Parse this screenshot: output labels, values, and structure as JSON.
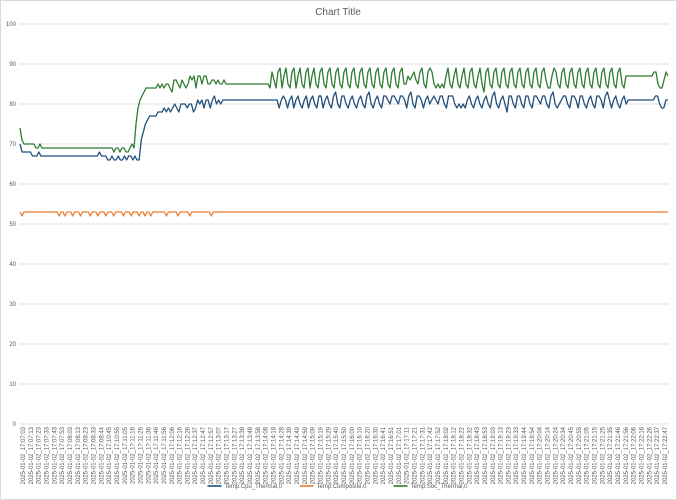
{
  "chart_data": {
    "type": "line",
    "title": "Chart Title",
    "xlabel": "",
    "ylabel": "",
    "ylim": [
      0,
      100
    ],
    "yticks": [
      0,
      10,
      20,
      30,
      40,
      50,
      60,
      70,
      80,
      90,
      100
    ],
    "grid": true,
    "legend_position": "bottom",
    "x_tick_labels": [
      "2025-01-02_17:07:03",
      "2025-01-02_17:07:13",
      "2025-01-02_17:07:23",
      "2025-01-02_17:07:33",
      "2025-01-02_17:07:43",
      "2025-01-02_17:07:53",
      "2025-01-02_17:08:03",
      "2025-01-02_17:08:13",
      "2025-01-02_17:08:23",
      "2025-01-02_17:08:33",
      "2025-01-02_17:08:44",
      "2025-01-02_17:10:45",
      "2025-01-02_17:10:55",
      "2025-01-02_17:11:05",
      "2025-01-02_17:11:16",
      "2025-01-02_17:11:26",
      "2025-01-02_17:11:36",
      "2025-01-02_17:11:46",
      "2025-01-02_17:11:56",
      "2025-01-02_17:12:06",
      "2025-01-02_17:12:16",
      "2025-01-02_17:12:26",
      "2025-01-02_17:12:37",
      "2025-01-02_17:12:47",
      "2025-01-02_17:12:57",
      "2025-01-02_17:13:07",
      "2025-01-02_17:13:17",
      "2025-01-02_17:13:27",
      "2025-01-02_17:13:38",
      "2025-01-02_17:13:48",
      "2025-01-02_17:13:58",
      "2025-01-02_17:14:08",
      "2025-01-02_17:14:18",
      "2025-01-02_17:14:28",
      "2025-01-02_17:14:39",
      "2025-01-02_17:14:49",
      "2025-01-02_17:14:59",
      "2025-01-02_17:15:09",
      "2025-01-02_17:15:19",
      "2025-01-02_17:15:29",
      "2025-01-02_17:15:40",
      "2025-01-02_17:15:50",
      "2025-01-02_17:16:00",
      "2025-01-02_17:16:10",
      "2025-01-02_17:16:20",
      "2025-01-02_17:16:30",
      "2025-01-02_17:16:41",
      "2025-01-02_17:16:51",
      "2025-01-02_17:17:01",
      "2025-01-02_17:17:11",
      "2025-01-02_17:17:21",
      "2025-01-02_17:17:31",
      "2025-01-02_17:17:42",
      "2025-01-02_17:17:52",
      "2025-01-02_17:18:02",
      "2025-01-02_17:18:12",
      "2025-01-02_17:18:22",
      "2025-01-02_17:18:32",
      "2025-01-02_17:18:43",
      "2025-01-02_17:18:53",
      "2025-01-02_17:19:03",
      "2025-01-02_17:19:13",
      "2025-01-02_17:19:23",
      "2025-01-02_17:19:33",
      "2025-01-02_17:19:44",
      "2025-01-02_17:19:54",
      "2025-01-02_17:20:04",
      "2025-01-02_17:20:14",
      "2025-01-02_17:20:24",
      "2025-01-02_17:20:34",
      "2025-01-02_17:20:45",
      "2025-01-02_17:20:55",
      "2025-01-02_17:21:05",
      "2025-01-02_17:21:15",
      "2025-01-02_17:21:25",
      "2025-01-02_17:21:35",
      "2025-01-02_17:21:46",
      "2025-01-02_17:21:56",
      "2025-01-02_17:22:06",
      "2025-01-02_17:22:16",
      "2025-01-02_17:22:26",
      "2025-01-02_17:22:37",
      "2025-01-02_17:22:47"
    ],
    "series": [
      {
        "name": "Temp:Cpu_Thermal,0",
        "color": "#1f4e79",
        "values": [
          70,
          68,
          68,
          68,
          68,
          68,
          67,
          67,
          67,
          68,
          67,
          67,
          67,
          67,
          67,
          67,
          67,
          67,
          67,
          67,
          67,
          67,
          67,
          67,
          67,
          67,
          67,
          67,
          67,
          67,
          67,
          67,
          67,
          67,
          67,
          67,
          67,
          67,
          68,
          67,
          67,
          67,
          66,
          66,
          67,
          66,
          66,
          67,
          66,
          66,
          67,
          66,
          67,
          67,
          66,
          67,
          66,
          66,
          71,
          73,
          75,
          76,
          77,
          77,
          77,
          77,
          78,
          78,
          78,
          79,
          78,
          79,
          78,
          79,
          80,
          79,
          78,
          80,
          80,
          80,
          79,
          80,
          80,
          78,
          79,
          81,
          80,
          81,
          79,
          81,
          81,
          79,
          81,
          82,
          80,
          81,
          80,
          81,
          81,
          81,
          81,
          81,
          81,
          81,
          81,
          81,
          81,
          81,
          81,
          81,
          81,
          81,
          81,
          81,
          81,
          81,
          81,
          81,
          81,
          81,
          81,
          81,
          81,
          81,
          79,
          81,
          82,
          81,
          79,
          81,
          82,
          79,
          81,
          82,
          80,
          79,
          81,
          82,
          79,
          81,
          82,
          80,
          79,
          82,
          82,
          79,
          81,
          82,
          80,
          79,
          82,
          83,
          80,
          79,
          82,
          82,
          80,
          79,
          81,
          82,
          80,
          79,
          81,
          82,
          80,
          79,
          82,
          83,
          80,
          79,
          81,
          82,
          80,
          79,
          82,
          82,
          81,
          80,
          82,
          82,
          81,
          80,
          82,
          82,
          81,
          79,
          82,
          83,
          80,
          79,
          82,
          82,
          81,
          79,
          81,
          82,
          80,
          81,
          82,
          81,
          80,
          82,
          82,
          80,
          79,
          82,
          82,
          82,
          80,
          79,
          80,
          79,
          80,
          79,
          81,
          82,
          80,
          79,
          81,
          82,
          80,
          79,
          81,
          82,
          80,
          79,
          82,
          83,
          80,
          79,
          81,
          82,
          80,
          78,
          82,
          82,
          80,
          79,
          82,
          82,
          80,
          79,
          82,
          82,
          80,
          79,
          82,
          82,
          81,
          80,
          82,
          82,
          80,
          79,
          82,
          83,
          80,
          79,
          80,
          81,
          82,
          82,
          80,
          79,
          82,
          82,
          81,
          79,
          82,
          82,
          80,
          79,
          81,
          82,
          80,
          79,
          82,
          82,
          81,
          79,
          82,
          83,
          81,
          79,
          81,
          82,
          80,
          79,
          81,
          82,
          80,
          81,
          81,
          81,
          81,
          81,
          81,
          81,
          81,
          81,
          81,
          81,
          81,
          81,
          82,
          82,
          80,
          79,
          79,
          81,
          81
        ]
      },
      {
        "name": "Temp:Composite,0",
        "color": "#ed7d31",
        "values": [
          53,
          52,
          53,
          53,
          53,
          53,
          53,
          53,
          53,
          53,
          53,
          53,
          53,
          53,
          53,
          53,
          53,
          53,
          53,
          53,
          52,
          53,
          53,
          52,
          53,
          53,
          53,
          52,
          53,
          53,
          53,
          52,
          53,
          53,
          53,
          53,
          52,
          53,
          53,
          53,
          52,
          53,
          53,
          53,
          52,
          53,
          53,
          53,
          52,
          53,
          53,
          53,
          53,
          52,
          53,
          53,
          53,
          52,
          53,
          53,
          53,
          52,
          53,
          53,
          52,
          53,
          53,
          52,
          53,
          53,
          53,
          53,
          53,
          53,
          53,
          52,
          53,
          53,
          53,
          53,
          53,
          52,
          53,
          53,
          53,
          53,
          53,
          52,
          53,
          53,
          53,
          53,
          53,
          53,
          53,
          53,
          53,
          53,
          52,
          53,
          53,
          53,
          53,
          53,
          53,
          53,
          53,
          53,
          53,
          53,
          53,
          53,
          53,
          53,
          53,
          53,
          53,
          53,
          53,
          53,
          53,
          53,
          53,
          53,
          53,
          53,
          53,
          53,
          53,
          53,
          53,
          53,
          53,
          53,
          53,
          53,
          53,
          53,
          53,
          53,
          53,
          53,
          53,
          53,
          53,
          53,
          53,
          53,
          53,
          53,
          53,
          53,
          53,
          53,
          53,
          53,
          53,
          53,
          53,
          53,
          53,
          53,
          53,
          53,
          53,
          53,
          53,
          53,
          53,
          53,
          53,
          53,
          53,
          53,
          53,
          53,
          53,
          53,
          53,
          53,
          53,
          53,
          53,
          53,
          53,
          53,
          53,
          53,
          53,
          53,
          53,
          53,
          53,
          53,
          53,
          53,
          53,
          53,
          53,
          53,
          53,
          53,
          53,
          53,
          53,
          53,
          53,
          53,
          53,
          53,
          53,
          53,
          53,
          53,
          53,
          53,
          53,
          53,
          53,
          53,
          53,
          53,
          53,
          53,
          53,
          53,
          53,
          53,
          53,
          53,
          53,
          53,
          53,
          53,
          53,
          53,
          53,
          53,
          53,
          53,
          53,
          53,
          53,
          53,
          53,
          53,
          53,
          53,
          53,
          53,
          53,
          53,
          53,
          53,
          53,
          53,
          53,
          53,
          53,
          53,
          53,
          53,
          53,
          53,
          53,
          53,
          53,
          53,
          53,
          53,
          53,
          53,
          53,
          53,
          53,
          53,
          53,
          53,
          53,
          53,
          53,
          53,
          53,
          53,
          53,
          53,
          53,
          53,
          53,
          53,
          53,
          53,
          53,
          53,
          53,
          53,
          53,
          53,
          53,
          53,
          53,
          53,
          53,
          53,
          53,
          53,
          53,
          53,
          53,
          53,
          53,
          53,
          53,
          53,
          53,
          53,
          53,
          53,
          53,
          53,
          53,
          53,
          53,
          53,
          53,
          53,
          53,
          53,
          53,
          53,
          53,
          53,
          53
        ]
      },
      {
        "name": "Temp:Soc_Thermal,0",
        "color": "#2e7d32",
        "values": [
          74,
          71,
          70,
          70,
          70,
          70,
          70,
          70,
          69,
          69,
          70,
          69,
          69,
          69,
          69,
          69,
          69,
          69,
          69,
          69,
          69,
          69,
          69,
          69,
          69,
          69,
          69,
          69,
          69,
          69,
          69,
          69,
          69,
          69,
          69,
          69,
          69,
          69,
          69,
          69,
          69,
          69,
          69,
          69,
          69,
          69,
          69,
          68,
          69,
          69,
          68,
          69,
          69,
          68,
          68,
          69,
          70,
          69,
          75,
          79,
          81,
          82,
          83,
          84,
          84,
          84,
          84,
          84,
          84,
          85,
          84,
          85,
          84,
          85,
          85,
          84,
          83,
          86,
          86,
          85,
          84,
          86,
          85,
          84,
          85,
          87,
          86,
          87,
          84,
          87,
          87,
          85,
          87,
          87,
          85,
          85,
          86,
          86,
          85,
          86,
          85,
          85,
          86,
          85,
          85,
          85,
          85,
          85,
          85,
          85,
          85,
          85,
          85,
          85,
          85,
          85,
          85,
          85,
          85,
          85,
          85,
          85,
          85,
          85,
          85,
          84,
          88,
          86,
          84,
          88,
          89,
          84,
          87,
          89,
          85,
          84,
          88,
          89,
          84,
          87,
          89,
          85,
          84,
          88,
          89,
          84,
          87,
          89,
          85,
          84,
          88,
          89,
          85,
          84,
          88,
          89,
          85,
          84,
          88,
          89,
          85,
          84,
          88,
          89,
          85,
          84,
          88,
          89,
          85,
          84,
          88,
          89,
          85,
          84,
          88,
          89,
          85,
          84,
          88,
          89,
          85,
          84,
          88,
          89,
          85,
          84,
          88,
          89,
          85,
          84,
          88,
          89,
          85,
          85,
          87,
          86,
          87,
          88,
          86,
          85,
          88,
          89,
          85,
          84,
          88,
          89,
          88,
          85,
          84,
          85,
          84,
          85,
          84,
          87,
          89,
          85,
          84,
          87,
          89,
          85,
          84,
          87,
          89,
          85,
          84,
          88,
          89,
          85,
          84,
          87,
          89,
          85,
          83,
          88,
          89,
          85,
          84,
          88,
          89,
          85,
          84,
          88,
          89,
          85,
          84,
          88,
          89,
          85,
          84,
          88,
          89,
          85,
          84,
          88,
          89,
          85,
          84,
          88,
          89,
          85,
          84,
          88,
          89,
          86,
          84,
          84,
          87,
          89,
          88,
          85,
          84,
          88,
          89,
          85,
          84,
          88,
          89,
          85,
          84,
          88,
          89,
          85,
          84,
          88,
          89,
          85,
          84,
          88,
          89,
          85,
          84,
          88,
          89,
          85,
          84,
          88,
          89,
          85,
          84,
          88,
          89,
          85,
          84,
          87,
          87,
          87,
          87,
          87,
          87,
          87,
          87,
          87,
          87,
          87,
          87,
          87,
          87,
          88,
          88,
          85,
          84,
          84,
          86,
          88,
          87
        ]
      }
    ]
  }
}
